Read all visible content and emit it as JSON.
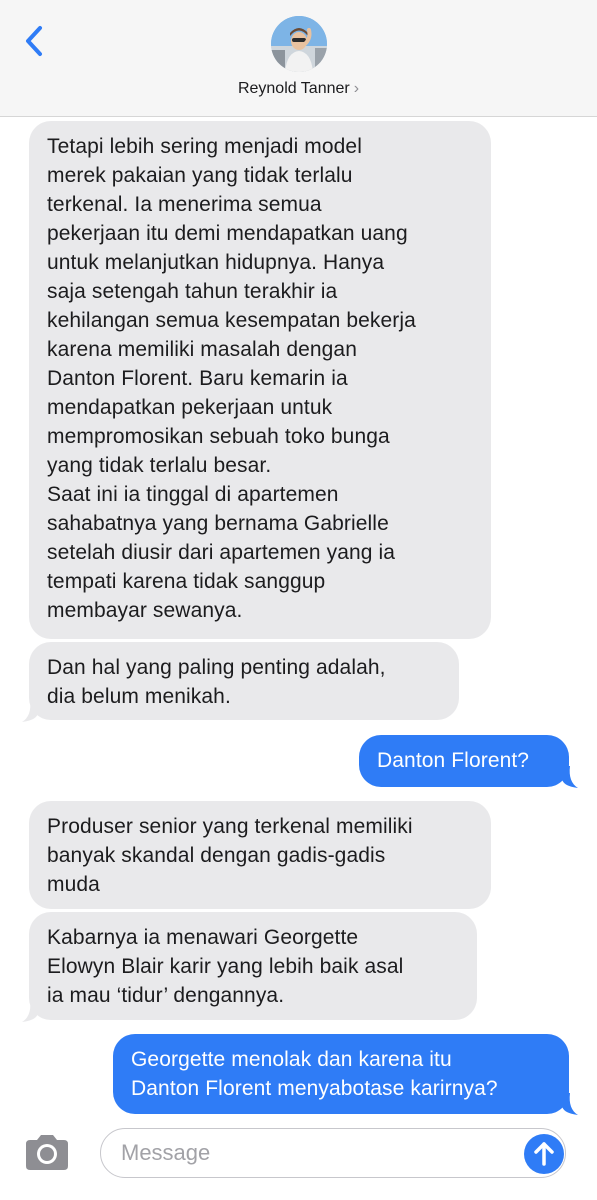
{
  "header": {
    "contact_name": "Reynold Tanner",
    "chevron": "›",
    "back_icon": "chevron-left-icon",
    "accent": "#2f7cf6"
  },
  "messages": [
    {
      "from": "them",
      "text": "Tetapi lebih sering menjadi model\nmerek pakaian yang tidak terlalu\nterkenal. Ia menerima semua\npekerjaan itu demi mendapatkan uang\nuntuk melanjutkan hidupnya.  Hanya\nsaja setengah tahun terakhir ia\nkehilangan semua kesempatan bekerja\nkarena memiliki masalah dengan\nDanton Florent. Baru kemarin ia\nmendapatkan pekerjaan untuk\nmempromosikan sebuah toko bunga\nyang tidak terlalu besar.\nSaat ini ia tinggal di apartemen\nsahabatnya yang bernama Gabrielle\nsetelah diusir dari apartemen yang ia\ntempati karena tidak sanggup\nmembayar sewanya."
    },
    {
      "from": "them",
      "text": "Dan hal yang paling penting adalah,\ndia belum menikah."
    },
    {
      "from": "me",
      "text": "Danton Florent?"
    },
    {
      "from": "them",
      "text": "Produser senior yang terkenal memiliki\nbanyak skandal dengan gadis-gadis\nmuda"
    },
    {
      "from": "them",
      "text": "Kabarnya ia menawari Georgette\nElowyn Blair karir yang lebih baik asal\nia mau ‘tidur’ dengannya."
    },
    {
      "from": "me",
      "text": "Georgette menolak dan karena itu\nDanton Florent menyabotase karirnya?"
    }
  ],
  "input": {
    "placeholder": "Message",
    "camera_icon": "camera-icon",
    "send_icon": "arrow-up-icon"
  },
  "colors": {
    "incoming_bubble": "#e9e9eb",
    "outgoing_bubble": "#2f7cf6",
    "header_bg": "#f6f6f6"
  }
}
